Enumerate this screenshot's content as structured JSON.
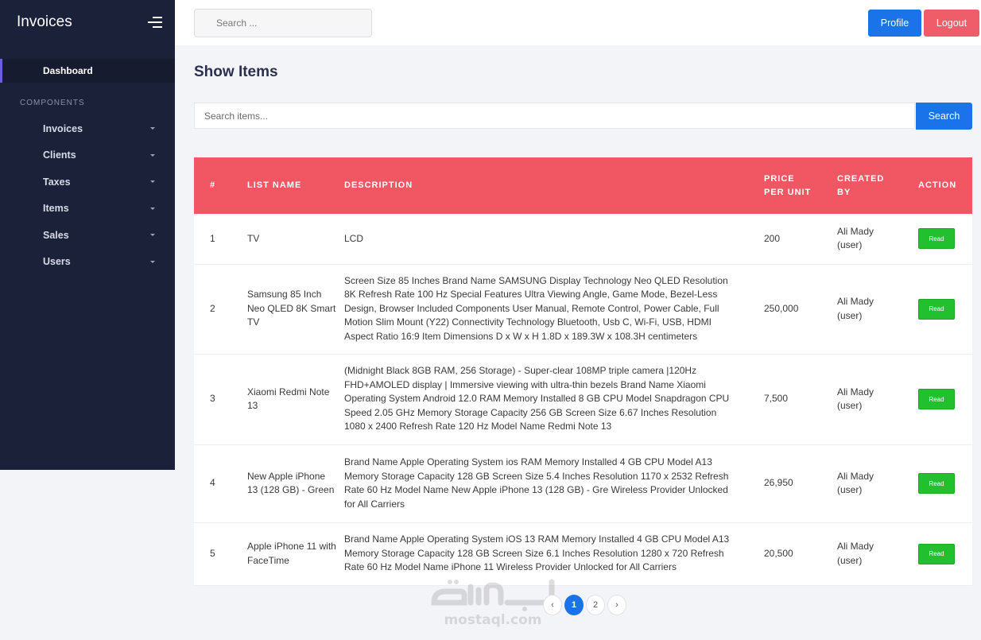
{
  "sidebar": {
    "brand": "Invoices",
    "dashboard": "Dashboard",
    "section_label": "COMPONENTS",
    "items": [
      {
        "label": "Invoices"
      },
      {
        "label": "Clients"
      },
      {
        "label": "Taxes"
      },
      {
        "label": "Items"
      },
      {
        "label": "Sales"
      },
      {
        "label": "Users"
      }
    ]
  },
  "topbar": {
    "search_placeholder": "Search ...",
    "profile_label": "Profile",
    "logout_label": "Logout"
  },
  "main": {
    "title": "Show Items",
    "search_placeholder": "Search items...",
    "search_button": "Search"
  },
  "table": {
    "headers": {
      "num": "#",
      "name": "LIST NAME",
      "description": "DESCRIPTION",
      "price": "PRICE PER UNIT",
      "created_by": "CREATED BY",
      "action": "ACTION"
    },
    "rows": [
      {
        "num": "1",
        "name": "TV",
        "description": "LCD",
        "price": "200",
        "created_by": "Ali Mady (user)",
        "action": "Read"
      },
      {
        "num": "2",
        "name": "Samsung 85 Inch Neo QLED 8K Smart TV",
        "description": "Screen Size 85 Inches Brand Name SAMSUNG Display Technology Neo QLED Resolution 8K Refresh Rate 100 Hz Special Features Ultra Viewing Angle, Game Mode, Bezel-Less Design, Browser Included Components User Manual, Remote Control, Power Cable, Full Motion Slim Mount (Y22) Connectivity Technology Bluetooth, Usb C, Wi-Fi, USB, HDMI Aspect Ratio 16:9 Item Dimensions D x W x H 1.8D x 189.3W x 108.3H centimeters",
        "price": "250,000",
        "created_by": "Ali Mady (user)",
        "action": "Read"
      },
      {
        "num": "3",
        "name": "Xiaomi Redmi Note 13",
        "description": "(Midnight Black 8GB RAM, 256 Storage) - Super-clear 108MP triple camera |120Hz FHD+AMOLED display | Immersive viewing with ultra-thin bezels Brand Name Xiaomi Operating System Android 12.0 RAM Memory Installed 8 GB CPU Model Snapdragon CPU Speed 2.05 GHz Memory Storage Capacity 256 GB Screen Size 6.67 Inches Resolution 1080 x 2400 Refresh Rate 120 Hz Model Name Redmi Note 13",
        "price": "7,500",
        "created_by": "Ali Mady (user)",
        "action": "Read"
      },
      {
        "num": "4",
        "name": "New Apple iPhone 13 (128 GB) - Green",
        "description": "Brand Name Apple Operating System ios RAM Memory Installed 4 GB CPU Model A13 Memory Storage Capacity 128 GB Screen Size 5.4 Inches Resolution 1170 x 2532 Refresh Rate 60 Hz Model Name New Apple iPhone 13 (128 GB) - Gre Wireless Provider Unlocked for All Carriers",
        "price": "26,950",
        "created_by": "Ali Mady (user)",
        "action": "Read"
      },
      {
        "num": "5",
        "name": "Apple iPhone 11 with FaceTime",
        "description": "Brand Name Apple Operating System iOS 13 RAM Memory Installed 4 GB CPU Model A13 Memory Storage Capacity 128 GB Screen Size 6.1 Inches Resolution 1280 x 720 Refresh Rate 60 Hz Model Name iPhone 11 Wireless Provider Unlocked for All Carriers",
        "price": "20,500",
        "created_by": "Ali Mady (user)",
        "action": "Read"
      }
    ]
  },
  "pagination": {
    "prev": "‹",
    "pages": [
      "1",
      "2"
    ],
    "next": "›",
    "active": "1"
  },
  "watermark": {
    "arabic": "مستقل",
    "latin": "mostaql.com"
  },
  "colors": {
    "sidebar_bg": "#1b2138",
    "header_red": "#f05762",
    "primary_blue": "#1a73e8",
    "logout_red": "#f05d6a",
    "read_green": "#22c02e"
  }
}
